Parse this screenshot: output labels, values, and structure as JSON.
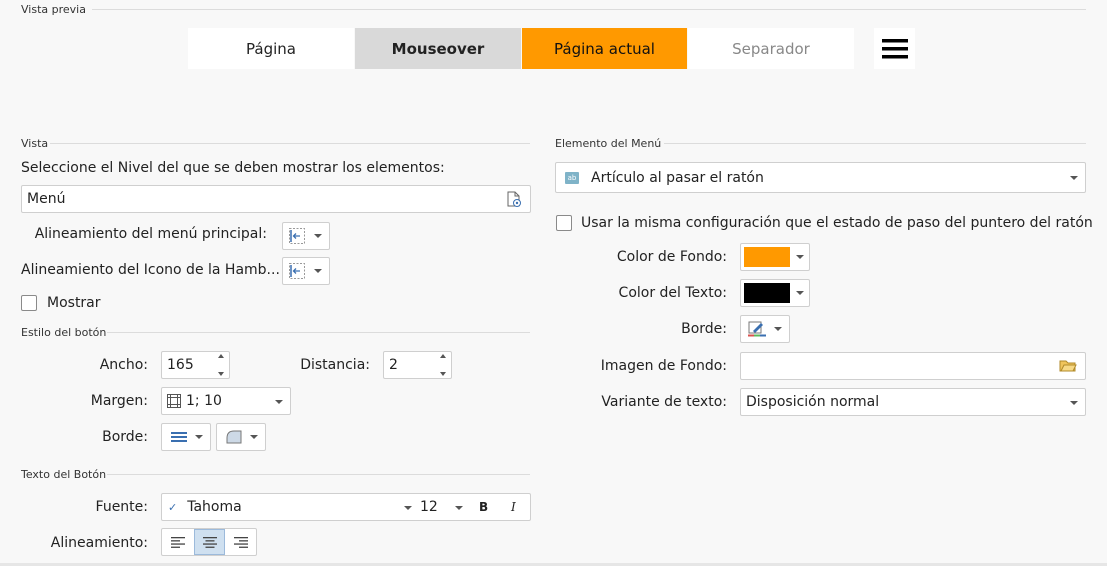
{
  "preview": {
    "section_title": "Vista previa",
    "tabs": [
      {
        "label": "Página"
      },
      {
        "label": "Mouseover"
      },
      {
        "label": "Página actual"
      },
      {
        "label": "Separador"
      }
    ],
    "hamburger_icon": "hamburger-menu-icon"
  },
  "vista": {
    "section_title": "Vista",
    "level_prompt": "Seleccione el Nivel del que se deben mostrar los elementos:",
    "level_value": "Menú",
    "main_menu_alignment_label": "Alineamiento del menú principal:",
    "hamburger_icon_alignment_label": "Alineamiento del Icono de la Hamb...",
    "show_label": "Mostrar",
    "show_checked": false
  },
  "button_style": {
    "section_title": "Estilo del botón",
    "width_label": "Ancho:",
    "width_value": "165",
    "distance_label": "Distancia:",
    "distance_value": "2",
    "margin_label": "Margen:",
    "margin_value": "1; 10",
    "border_label": "Borde:"
  },
  "button_text": {
    "section_title": "Texto del Botón",
    "font_label": "Fuente:",
    "font_value": "Tahoma",
    "font_size": "12",
    "bold_label": "B",
    "italic_label": "I",
    "alignment_label": "Alineamiento:",
    "alignment_selected": "center"
  },
  "menu_element": {
    "section_title": "Elemento del Menú",
    "selected_element": "Artículo al pasar el ratón",
    "same_config_label": "Usar la misma configuración que el estado de paso del puntero del ratón",
    "same_config_checked": false,
    "bg_color_label": "Color de Fondo:",
    "bg_color": "#ff9900",
    "text_color_label": "Color del Texto:",
    "text_color": "#000000",
    "border_label": "Borde:",
    "bg_image_label": "Imagen de Fondo:",
    "bg_image_value": "",
    "text_variant_label": "Variante de texto:",
    "text_variant_value": "Disposición normal"
  },
  "colors": {
    "accent_orange": "#ff9900",
    "hover_gray": "#d9d9d9"
  }
}
